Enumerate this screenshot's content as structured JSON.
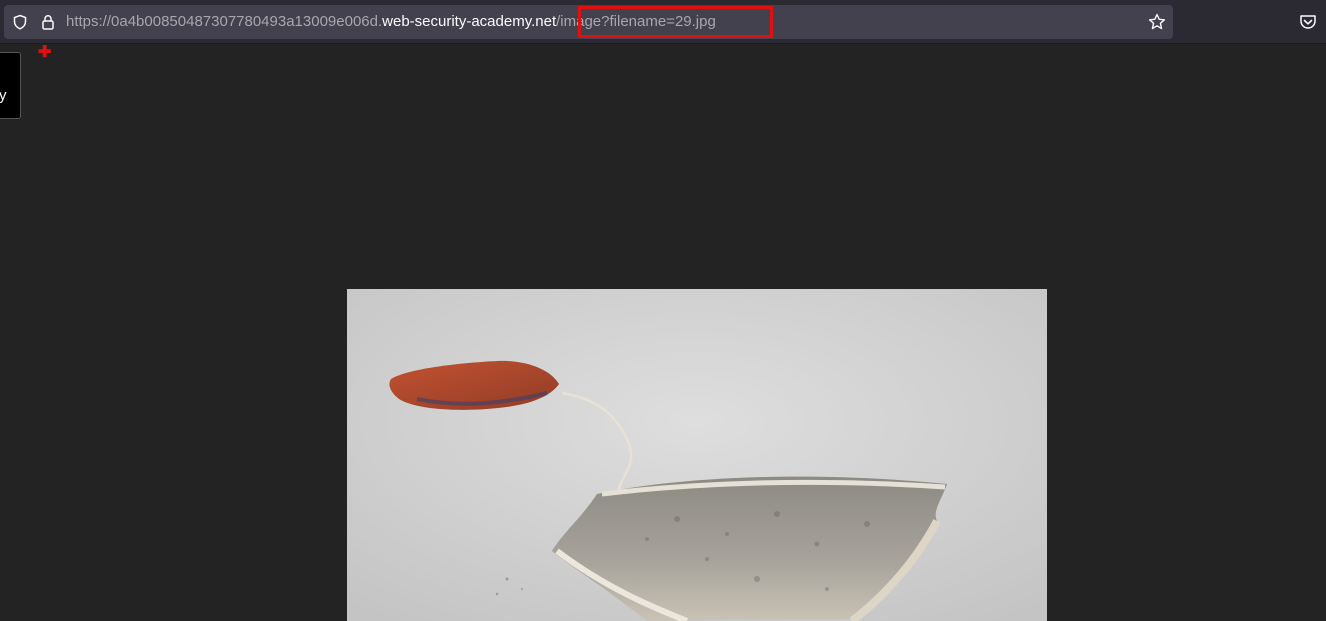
{
  "browser": {
    "url_prefix": "https://0a4b00850487307780493a13009e006d.",
    "url_host": "web-security-academy.net",
    "url_path": "/image?filename=29.jpg"
  },
  "page": {
    "side_tab_text": "y",
    "image_alt": "tea bag photo"
  },
  "colors": {
    "toolbar_bg": "#2b2a33",
    "urlbar_bg": "#42414d",
    "page_bg": "#232323",
    "highlight": "#e01010"
  },
  "icons": [
    "shield-icon",
    "lock-icon",
    "star-icon",
    "pocket-icon",
    "red-cross-icon"
  ]
}
